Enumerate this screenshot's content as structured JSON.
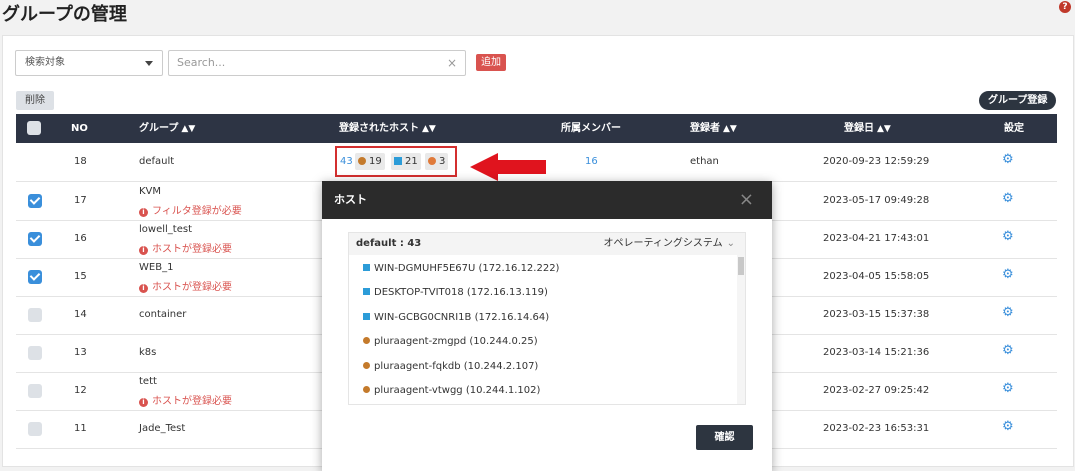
{
  "title": "グループの管理",
  "toolbar": {
    "select_value": "検索対象",
    "search_placeholder": "Search...",
    "clear_icon": "×",
    "add_label": "追加",
    "delete_label": "削除",
    "register_label": "グループ登録"
  },
  "columns": {
    "no": "NO",
    "group": "グループ",
    "hosts": "登録されたホスト",
    "members": "所属メンバー",
    "creator": "登録者",
    "date": "登録日",
    "settings": "設定"
  },
  "rows": [
    {
      "no": "18",
      "group": "default",
      "warning": "",
      "checked": false,
      "date": "2020-09-23 12:59:29"
    },
    {
      "no": "17",
      "group": "KVM",
      "warning": "フィルタ登録が必要",
      "checked": true,
      "date": "2023-05-17 09:49:28"
    },
    {
      "no": "16",
      "group": "lowell_test",
      "warning": "ホストが登録必要",
      "checked": true,
      "date": "2023-04-21 17:43:01"
    },
    {
      "no": "15",
      "group": "WEB_1",
      "warning": "ホストが登録必要",
      "checked": true,
      "date": "2023-04-05 15:58:05"
    },
    {
      "no": "14",
      "group": "container",
      "warning": "",
      "checked": false,
      "date": "2023-03-15 15:37:38"
    },
    {
      "no": "13",
      "group": "k8s",
      "warning": "",
      "checked": false,
      "date": "2023-03-14 15:21:36"
    },
    {
      "no": "12",
      "group": "tett",
      "warning": "ホストが登録必要",
      "checked": false,
      "date": "2023-02-27 09:25:42"
    },
    {
      "no": "11",
      "group": "Jade_Test",
      "warning": "",
      "checked": false,
      "date": "2023-02-23 16:53:31"
    }
  ],
  "first_row": {
    "host_total": "43",
    "linux_count": "19",
    "windows_count": "21",
    "other_count": "3",
    "members": "16",
    "creator": "ethan"
  },
  "modal": {
    "title": "ホスト",
    "close": "×",
    "list_title": "default : 43",
    "sort_label": "オペレーティングシステム",
    "items": [
      {
        "os": "windows",
        "label": "WIN-DGMUHF5E67U (172.16.12.222)"
      },
      {
        "os": "windows",
        "label": "DESKTOP-TVIT018 (172.16.13.119)"
      },
      {
        "os": "windows",
        "label": "WIN-GCBG0CNRI1B (172.16.14.64)"
      },
      {
        "os": "linux",
        "label": "pluraagent-zmgpd (10.244.0.25)"
      },
      {
        "os": "linux",
        "label": "pluraagent-fqkdb (10.244.2.107)"
      },
      {
        "os": "linux",
        "label": "pluraagent-vtwgg (10.244.1.102)"
      }
    ],
    "confirm": "確認"
  },
  "colors": {
    "accent": "#3a8fdb",
    "danger": "#d9534f",
    "header": "#2d3444",
    "highlight": "#d32f2f"
  }
}
